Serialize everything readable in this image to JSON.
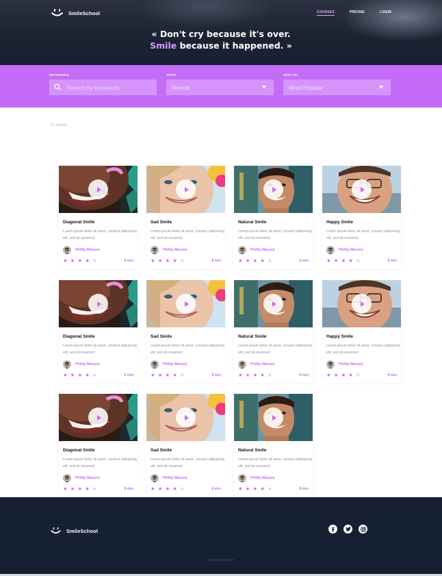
{
  "brand": {
    "name": "SmileSchool",
    "logo_icon": "smile-logo-icon"
  },
  "nav": [
    {
      "label": "COURSES",
      "active": true
    },
    {
      "label": "PRICING",
      "active": false
    },
    {
      "label": "LOGIN",
      "active": false
    }
  ],
  "hero": {
    "quote_open": "« Don't cry because it's over.",
    "quote_accent": "Smile",
    "quote_rest": " because it happened. »"
  },
  "filters": {
    "keywords": {
      "label": "KEYWORDS",
      "placeholder": "Search by keywords",
      "icon": "search-icon"
    },
    "topic": {
      "label": "TOPIC",
      "value": "Novice"
    },
    "sort": {
      "label": "SORT BY",
      "value": "Most Popular"
    }
  },
  "results": {
    "count_text": "11 videos"
  },
  "videos": [
    {
      "title": "Diagonal Smile",
      "description": "Lorem ipsum dolor sit amet, consect adipiscing elit, sed do eiusmod.",
      "author": "Phillip Massey",
      "rating": 4,
      "duration": "8 min"
    },
    {
      "title": "Sad Smile",
      "description": "Lorem ipsum dolor sit amet, consect adipiscing elit, sed do eiusmod.",
      "author": "Phillip Massey",
      "rating": 4,
      "duration": "8 min"
    },
    {
      "title": "Natural Smile",
      "description": "Lorem ipsum dolor sit amet, consect adipiscing elit, sed do eiusmod.",
      "author": "Phillip Massey",
      "rating": 4,
      "duration": "8 min"
    },
    {
      "title": "Happy Smile",
      "description": "Lorem ipsum dolor sit amet, consect adipiscing elit, sed do eiusmod.",
      "author": "Phillip Massey",
      "rating": 4,
      "duration": "8 min"
    },
    {
      "title": "Diagonal Smile",
      "description": "Lorem ipsum dolor sit amet, consect adipiscing elit, sed do eiusmod.",
      "author": "Phillip Massey",
      "rating": 4,
      "duration": "8 min"
    },
    {
      "title": "Sad Smile",
      "description": "Lorem ipsum dolor sit amet, consect adipiscing elit, sed do eiusmod.",
      "author": "Phillip Massey",
      "rating": 4,
      "duration": "8 min"
    },
    {
      "title": "Natural Smile",
      "description": "Lorem ipsum dolor sit amet, consect adipiscing elit, sed do eiusmod.",
      "author": "Phillip Massey",
      "rating": 4,
      "duration": "8 min"
    },
    {
      "title": "Happy Smile",
      "description": "Lorem ipsum dolor sit amet, consect adipiscing elit, sed do eiusmod.",
      "author": "Phillip Massey",
      "rating": 4,
      "duration": "8 min"
    },
    {
      "title": "Diagonal Smile",
      "description": "Lorem ipsum dolor sit amet, consect adipiscing elit, sed do eiusmod.",
      "author": "Phillip Massey",
      "rating": 4,
      "duration": "8 min"
    },
    {
      "title": "Sad Smile",
      "description": "Lorem ipsum dolor sit amet, consect adipiscing elit, sed do eiusmod.",
      "author": "Phillip Massey",
      "rating": 4,
      "duration": "8 min"
    },
    {
      "title": "Natural Smile",
      "description": "Lorem ipsum dolor sit amet, consect adipiscing elit, sed do eiusmod.",
      "author": "Phillip Massey",
      "rating": 4,
      "duration": "8 min"
    }
  ],
  "footer": {
    "brand": "SmileSchool",
    "social_icons": [
      "facebook-icon",
      "twitter-icon",
      "instagram-icon"
    ],
    "copyright": "©smileschool 2020"
  },
  "colors": {
    "accent": "#c46cf7",
    "dark": "#162033",
    "filter_box": "#d694fb"
  }
}
